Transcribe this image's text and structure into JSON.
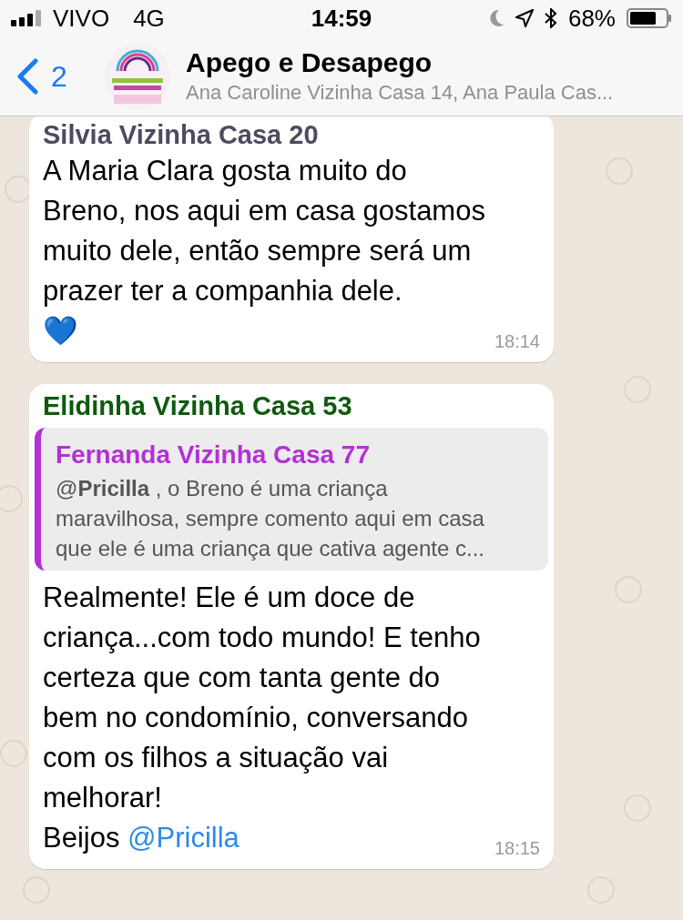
{
  "status_bar": {
    "carrier": "VIVO",
    "network": "4G",
    "time": "14:59",
    "battery": "68%"
  },
  "header": {
    "back_count": "2",
    "title": "Apego e Desapego",
    "subtitle": "Ana Caroline Vizinha Casa 14, Ana Paula Cas..."
  },
  "messages": [
    {
      "sender": "Silvia Vizinha Casa 20",
      "color": "#4f4a5e",
      "parts": [
        {
          "kind": "text",
          "text": "A Maria Clara gosta muito do\nBreno, nos aqui em casa gostamos\nmuito dele, então sempre será um\nprazer ter a companhia dele.\n💙"
        }
      ],
      "time": "18:14"
    },
    {
      "sender": "Elidinha Vizinha Casa 53",
      "color": "#0f5a0f",
      "quote": {
        "sender": "Fernanda Vizinha Casa 77",
        "color": "#b42fd6",
        "text": "@**Pricilla** , o Breno é uma criança\nmaravilhosa, sempre comento aqui em casa\nque ele é uma criança que cativa agente c..."
      },
      "parts": [
        {
          "kind": "text",
          "text": "Realmente! Ele é um doce de\ncriança...com todo mundo! E tenho\ncerteza que com tanta gente do\nbem no condomínio, conversando\ncom os filhos a situação vai\nmelhorar!\nBeijos "
        },
        {
          "kind": "mention",
          "text": "@Pricilla"
        }
      ],
      "time": "18:15"
    }
  ]
}
